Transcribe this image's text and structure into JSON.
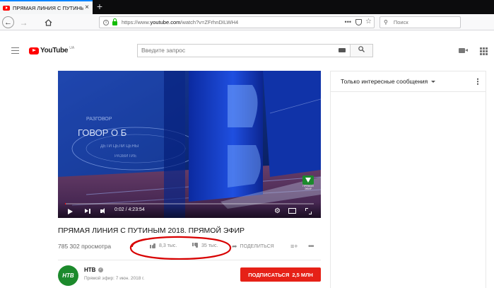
{
  "browser": {
    "tab_title": "ПРЯМАЯ ЛИНИЯ С ПУТИНЫМ",
    "close_label": "×",
    "new_tab_label": "+",
    "url_prefix": "https://www.",
    "url_domain": "youtube.com",
    "url_path": "/watch?v=ZFrhnDILWH4",
    "search_placeholder": "Поиск",
    "icons": [
      "back-icon",
      "forward-icon",
      "home-icon",
      "info-icon",
      "lock-icon",
      "page-actions-icon",
      "pocket-icon",
      "bookmark-star-icon",
      "search-icon"
    ]
  },
  "youtube": {
    "logo_text": "YouTube",
    "logo_region": "UA",
    "search_placeholder": "Введите запрос",
    "icons": [
      "menu-icon",
      "keyboard-icon",
      "search-icon",
      "upload-camera-icon",
      "apps-grid-icon"
    ]
  },
  "player": {
    "time_label": "0:02 / 4:23:54",
    "progress": 0.0001,
    "watermark_label": "ПРЯМОЙ ЭФИР",
    "accent_color": "#ff0000"
  },
  "video": {
    "title": "ПРЯМАЯ ЛИНИЯ С ПУТИНЫМ 2018. ПРЯМОЙ ЭФИР",
    "views": "785 302 просмотра",
    "likes": "8,3 тыс.",
    "dislikes": "35 тыс.",
    "share_label": "ПОДЕЛИТЬСЯ",
    "add_label": "≡+",
    "more_label": "•••"
  },
  "channel": {
    "name": "НТВ",
    "avatar_text": "НТВ",
    "verified": "✓",
    "publish_date": "Прямой эфир: 7 июн. 2018 г.",
    "subscribe_label": "ПОДПИСАТЬСЯ",
    "subscriber_count": "2,5 МЛН",
    "subscribe_color": "#e62117"
  },
  "chat": {
    "mode_label": "Только интересные сообщения"
  },
  "annotation": {
    "color": "#d80000"
  }
}
